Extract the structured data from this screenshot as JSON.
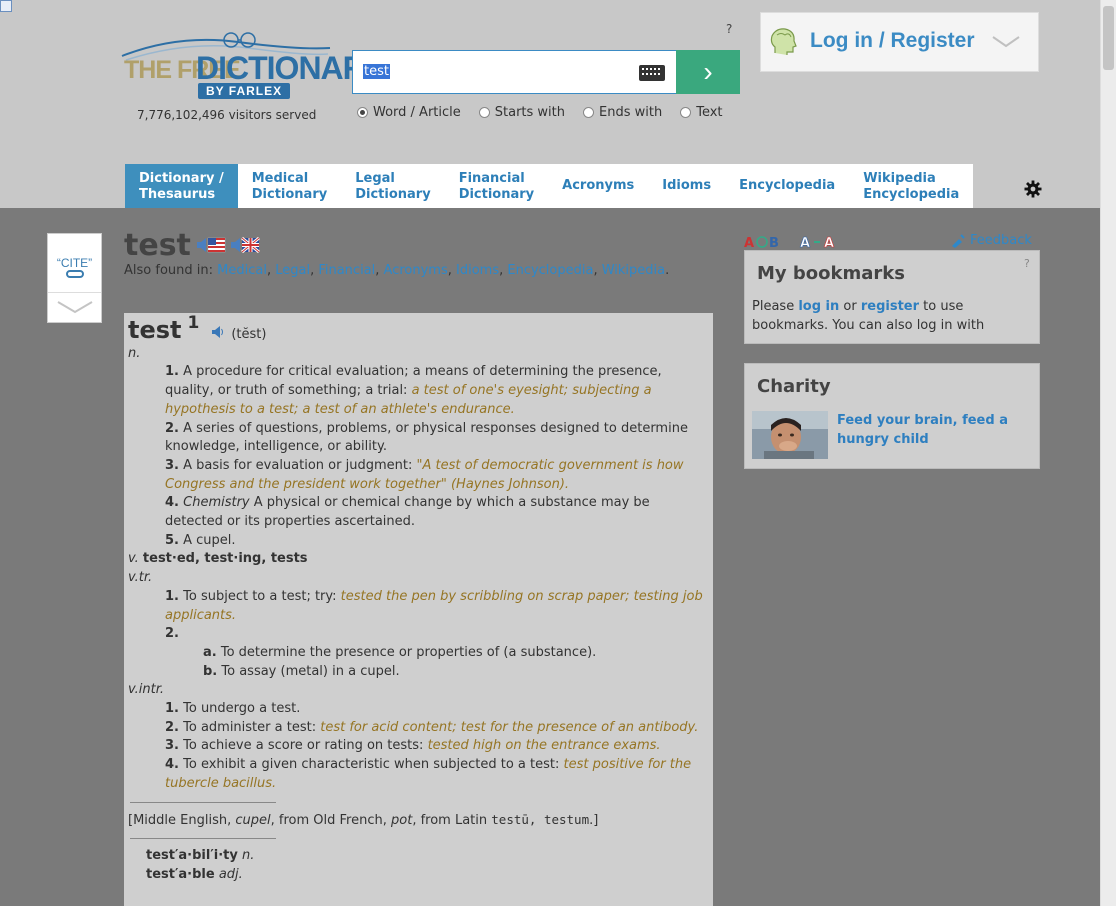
{
  "header": {
    "visitors": "7,776,102,496 visitors served",
    "help_mark": "?",
    "search_value": "test",
    "search_button": "›",
    "modes": [
      {
        "label": "Word / Article",
        "checked": true
      },
      {
        "label": "Starts with",
        "checked": false
      },
      {
        "label": "Ends with",
        "checked": false
      },
      {
        "label": "Text",
        "checked": false
      }
    ],
    "login_label": "Log in / Register"
  },
  "logo": {
    "the_free": "THE FREE",
    "dictionary": "DICTIONARY",
    "by_farlex": "BY FARLEX"
  },
  "tabs": [
    {
      "line1": "Dictionary /",
      "line2": "Thesaurus",
      "active": true
    },
    {
      "line1": "Medical",
      "line2": "Dictionary",
      "active": false
    },
    {
      "line1": "Legal",
      "line2": "Dictionary",
      "active": false
    },
    {
      "line1": "Financial",
      "line2": "Dictionary",
      "active": false
    },
    {
      "line1": "Acronyms",
      "line2": "",
      "active": false
    },
    {
      "line1": "Idioms",
      "line2": "",
      "active": false
    },
    {
      "line1": "Encyclopedia",
      "line2": "",
      "active": false
    },
    {
      "line1": "Wikipedia",
      "line2": "Encyclopedia",
      "active": false
    }
  ],
  "cite": {
    "label": "“CITE”"
  },
  "word": {
    "title": "test",
    "also_found_prefix": "Also found in:",
    "also_found": [
      "Medical",
      "Legal",
      "Financial",
      "Acronyms",
      "Idioms",
      "Encyclopedia",
      "Wikipedia"
    ]
  },
  "entry": {
    "word": "test",
    "sup": "1",
    "pron": "(tĕst)",
    "pos_n": "n.",
    "noun_senses": [
      {
        "num": "1.",
        "text": "A procedure for critical evaluation; a means of determining the presence, quality, or truth of something; a trial:",
        "ex": "a test of one's eyesight; subjecting a hypothesis to a test; a test of an athlete's endurance."
      },
      {
        "num": "2.",
        "text": "A series of questions, problems, or physical responses designed to determine knowledge, intelligence, or ability.",
        "ex": ""
      },
      {
        "num": "3.",
        "text": "A basis for evaluation or judgment:",
        "ex": "\"A test of democratic government is how Congress and the president work together\" (Haynes Johnson)."
      },
      {
        "num": "4.",
        "label": "Chemistry",
        "text": "A physical or chemical change by which a substance may be detected or its properties ascertained.",
        "ex": ""
      },
      {
        "num": "5.",
        "text": "A cupel.",
        "ex": ""
      }
    ],
    "pos_v": "v.",
    "forms": "test·ed, test·ing, tests",
    "pos_vtr": "v.tr.",
    "vtr_1_num": "1.",
    "vtr_1_text": "To subject to a test; try:",
    "vtr_1_ex": "tested the pen by scribbling on scrap paper; testing job applicants.",
    "vtr_2_num": "2.",
    "vtr_2a_num": "a.",
    "vtr_2a_text": "To determine the presence or properties of (a substance).",
    "vtr_2b_num": "b.",
    "vtr_2b_text": "To assay (metal) in a cupel.",
    "pos_vintr": "v.intr.",
    "vintr_senses": [
      {
        "num": "1.",
        "text": "To undergo a test.",
        "ex": ""
      },
      {
        "num": "2.",
        "text": "To administer a test:",
        "ex": "test for acid content; test for the presence of an antibody."
      },
      {
        "num": "3.",
        "text": "To achieve a score or rating on tests:",
        "ex": "tested high on the entrance exams."
      },
      {
        "num": "4.",
        "text": "To exhibit a given characteristic when subjected to a test:",
        "ex": "test positive for the tubercle bacillus."
      }
    ],
    "etym_1": "[Middle English,",
    "etym_cupel": "cupel",
    "etym_2": ", from Old French,",
    "etym_pot": "pot",
    "etym_3": ", from Latin",
    "etym_latin": "testū, testum",
    "etym_4": ".]",
    "deriv_1_word": "test′a·bil′i·ty",
    "deriv_1_pos": "n.",
    "deriv_2_word": "test′a·ble",
    "deriv_2_pos": "adj."
  },
  "sidebar": {
    "feedback": "Feedback",
    "bookmarks_title": "My bookmarks",
    "bookmarks_help": "?",
    "bm_please": "Please",
    "bm_login": "log in",
    "bm_or": "or",
    "bm_register": "register",
    "bm_rest": "to use bookmarks. You can also log in with",
    "charity_title": "Charity",
    "charity_link": "Feed your brain, feed a hungry child"
  }
}
